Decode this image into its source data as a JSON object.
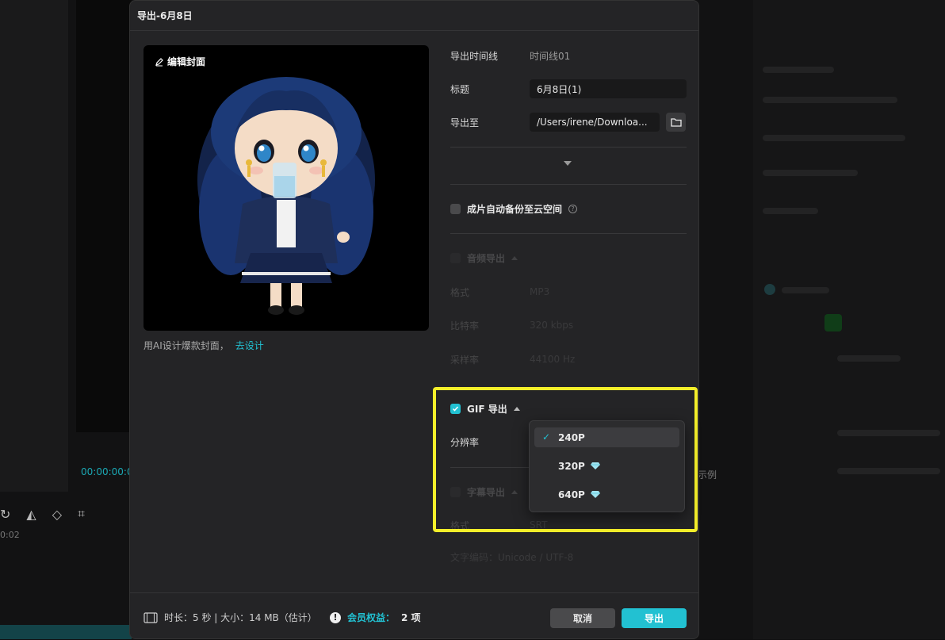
{
  "background": {
    "timecode": "00:00:00:0",
    "ruler_label": "0:02",
    "example_text": "示例"
  },
  "dialog": {
    "title": "导出-6月8日",
    "cover": {
      "edit_label": "编辑封面",
      "ai_hint": "用AI设计爆款封面，",
      "ai_link": "去设计"
    },
    "form": {
      "timeline_label": "导出时间线",
      "timeline_value": "时间线01",
      "title_label": "标题",
      "title_value": "6月8日(1)",
      "export_to_label": "导出至",
      "export_path": "/Users/irene/Downloa...",
      "cloud_backup_label": "成片自动备份至云空间",
      "audio": {
        "title": "音频导出",
        "format_label": "格式",
        "format_value": "MP3",
        "bitrate_label": "比特率",
        "bitrate_value": "320 kbps",
        "sample_label": "采样率",
        "sample_value": "44100 Hz"
      },
      "gif": {
        "title": "GIF 导出",
        "resolution_label": "分辨率"
      },
      "subtitle": {
        "title": "字幕导出",
        "format_label": "格式",
        "format_value": "SRT",
        "encoding": "文字编码：Unicode / UTF-8"
      }
    },
    "dropdown": {
      "options": [
        {
          "label": "240P",
          "selected": true,
          "premium": false
        },
        {
          "label": "320P",
          "selected": false,
          "premium": true
        },
        {
          "label": "640P",
          "selected": false,
          "premium": true
        }
      ]
    },
    "footer": {
      "info": "时长：5 秒 | 大小：14 MB（估计）",
      "member_label": "会员权益：",
      "member_count": "2 项",
      "cancel_label": "取消",
      "export_label": "导出"
    }
  },
  "colors": {
    "accent": "#22c1d2",
    "highlight": "#f4ef2a"
  }
}
